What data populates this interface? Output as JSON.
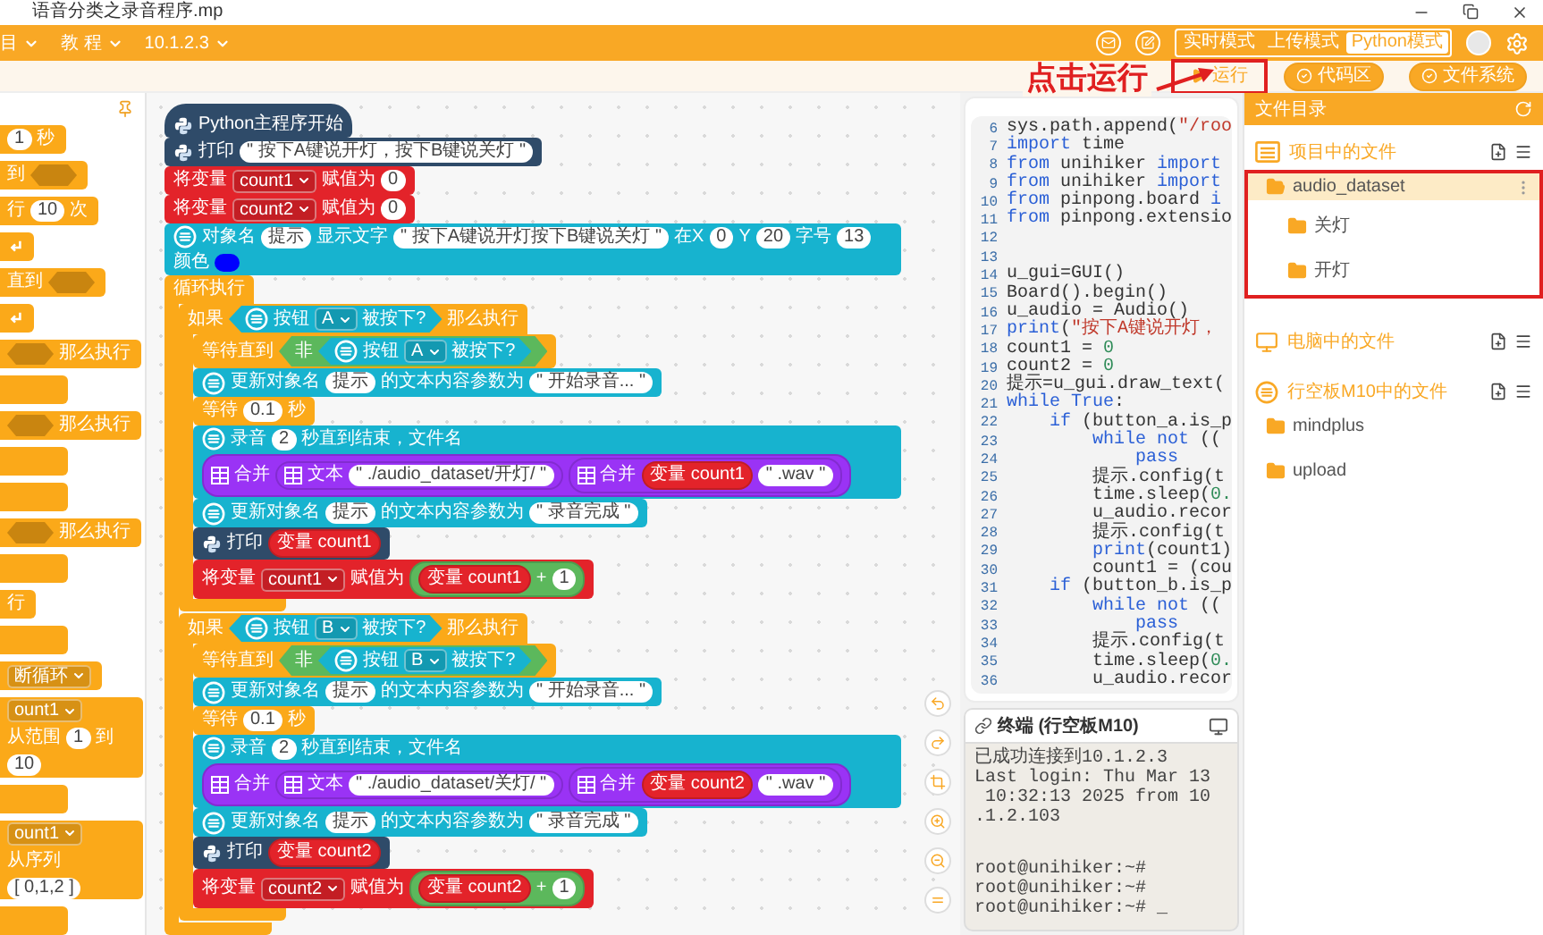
{
  "window": {
    "title": "语音分类之录音程序.mp"
  },
  "menus": [
    {
      "label": "目"
    },
    {
      "label": "教 程"
    },
    {
      "label": "10.1.2.3"
    }
  ],
  "modes": [
    {
      "label": "实时模式",
      "selected": false
    },
    {
      "label": "上传模式",
      "selected": false
    },
    {
      "label": "Python模式",
      "selected": true
    }
  ],
  "toolbar": [
    {
      "kind": "run",
      "label": "运行",
      "highlighted": true
    },
    {
      "kind": "toggle",
      "label": "代码区",
      "highlighted": false
    },
    {
      "kind": "toggle",
      "label": "文件系统",
      "highlighted": false
    }
  ],
  "annotation": {
    "text": "点击运行"
  },
  "palette": [
    {
      "kind": "block",
      "parts": [
        {
          "kind": "input",
          "text": "1"
        },
        {
          "kind": "label",
          "text": "秒"
        }
      ]
    },
    {
      "kind": "block",
      "parts": [
        {
          "kind": "label",
          "text": "到"
        },
        {
          "kind": "slot"
        }
      ]
    },
    {
      "kind": "block",
      "parts": [
        {
          "kind": "label",
          "text": "行"
        },
        {
          "kind": "input",
          "text": "10"
        },
        {
          "kind": "label",
          "text": "次"
        }
      ]
    },
    {
      "kind": "block",
      "parts": [
        {
          "kind": "arrow_icon"
        }
      ]
    },
    {
      "kind": "block",
      "parts": [
        {
          "kind": "label",
          "text": "直到"
        },
        {
          "kind": "slot"
        }
      ]
    },
    {
      "kind": "block",
      "parts": [
        {
          "kind": "arrow_icon"
        }
      ]
    },
    {
      "kind": "block",
      "parts": [
        {
          "kind": "slot"
        },
        {
          "kind": "label",
          "text": "那么执行"
        }
      ]
    },
    {
      "kind": "empty"
    },
    {
      "kind": "block",
      "parts": [
        {
          "kind": "slot"
        },
        {
          "kind": "label",
          "text": "那么执行"
        }
      ]
    },
    {
      "kind": "empty"
    },
    {
      "kind": "empty"
    },
    {
      "kind": "block",
      "parts": [
        {
          "kind": "slot"
        },
        {
          "kind": "label",
          "text": "那么执行"
        }
      ]
    },
    {
      "kind": "empty"
    },
    {
      "kind": "block",
      "parts": [
        {
          "kind": "label",
          "text": "行"
        }
      ]
    },
    {
      "kind": "empty"
    },
    {
      "kind": "block",
      "parts": [
        {
          "kind": "dropdown",
          "text": "断循环"
        }
      ]
    },
    {
      "kind": "block",
      "parts": [
        {
          "kind": "dropdown",
          "text": "ount1"
        },
        {
          "kind": "label",
          "text": "从范围"
        },
        {
          "kind": "input",
          "text": "1"
        },
        {
          "kind": "label",
          "text": "到"
        },
        {
          "kind": "input",
          "text": "10"
        }
      ]
    },
    {
      "kind": "empty"
    },
    {
      "kind": "block",
      "parts": [
        {
          "kind": "dropdown",
          "text": "ount1"
        },
        {
          "kind": "label",
          "text": "从序列"
        },
        {
          "kind": "input",
          "text": "[ 0,1,2 ]"
        }
      ]
    },
    {
      "kind": "empty"
    }
  ],
  "script": [
    {
      "kind": "python_hat",
      "parts": [
        {
          "kind": "python_icon"
        },
        {
          "kind": "label",
          "text": "Python主程序开始"
        }
      ]
    },
    {
      "kind": "python_statement",
      "parts": [
        {
          "kind": "python_icon"
        },
        {
          "kind": "label",
          "text": "打印"
        },
        {
          "kind": "input",
          "text": "\" 按下A键说开灯，按下B键说关灯 \""
        }
      ]
    },
    {
      "kind": "variable_statement",
      "parts": [
        {
          "kind": "label",
          "text": "将变量"
        },
        {
          "kind": "dropdown",
          "text": "count1"
        },
        {
          "kind": "label",
          "text": "赋值为"
        },
        {
          "kind": "input",
          "text": "0"
        }
      ]
    },
    {
      "kind": "variable_statement",
      "parts": [
        {
          "kind": "label",
          "text": "将变量"
        },
        {
          "kind": "dropdown",
          "text": "count2"
        },
        {
          "kind": "label",
          "text": "赋值为"
        },
        {
          "kind": "input",
          "text": "0"
        }
      ]
    },
    {
      "kind": "gui_statement",
      "parts": [
        {
          "kind": "gui_icon"
        },
        {
          "kind": "label",
          "text": "对象名"
        },
        {
          "kind": "input",
          "text": "提示"
        },
        {
          "kind": "label",
          "text": "显示文字"
        },
        {
          "kind": "input",
          "text": "\" 按下A键说开灯按下B键说关灯 \""
        },
        {
          "kind": "label",
          "text": "在X"
        },
        {
          "kind": "input",
          "text": "0"
        },
        {
          "kind": "label",
          "text": "Y"
        },
        {
          "kind": "input",
          "text": "20"
        },
        {
          "kind": "label",
          "text": "字号"
        },
        {
          "kind": "input",
          "text": "13"
        },
        {
          "kind": "label",
          "text": "颜色"
        },
        {
          "kind": "color",
          "color": "#0000ff"
        }
      ]
    },
    {
      "kind": "control_c_block",
      "parts": [
        {
          "kind": "label",
          "text": "循环执行"
        }
      ],
      "children": [
        {
          "kind": "control_c_block",
          "parts": [
            {
              "kind": "label",
              "text": "如果"
            },
            {
              "kind": "gui_condition",
              "parts": [
                {
                  "kind": "gui_icon"
                },
                {
                  "kind": "label",
                  "text": "按钮"
                },
                {
                  "kind": "dropdown",
                  "text": "A"
                },
                {
                  "kind": "label",
                  "text": "被按下?"
                }
              ]
            },
            {
              "kind": "label",
              "text": "那么执行"
            }
          ],
          "children": [
            {
              "kind": "control_statement",
              "parts": [
                {
                  "kind": "label",
                  "text": "等待直到"
                },
                {
                  "kind": "logic_condition",
                  "parts": [
                    {
                      "kind": "label",
                      "text": "非"
                    },
                    {
                      "kind": "gui_condition",
                      "parts": [
                        {
                          "kind": "gui_icon"
                        },
                        {
                          "kind": "label",
                          "text": "按钮"
                        },
                        {
                          "kind": "dropdown",
                          "text": "A"
                        },
                        {
                          "kind": "label",
                          "text": "被按下?"
                        }
                      ]
                    }
                  ]
                }
              ]
            },
            {
              "kind": "gui_statement",
              "parts": [
                {
                  "kind": "gui_icon"
                },
                {
                  "kind": "label",
                  "text": "更新对象名"
                },
                {
                  "kind": "input",
                  "text": "提示"
                },
                {
                  "kind": "label",
                  "text": "的文本内容参数为"
                },
                {
                  "kind": "input",
                  "text": "\" 开始录音... \""
                }
              ]
            },
            {
              "kind": "control_statement",
              "parts": [
                {
                  "kind": "label",
                  "text": "等待"
                },
                {
                  "kind": "input",
                  "text": "0.1"
                },
                {
                  "kind": "label",
                  "text": "秒"
                }
              ]
            },
            {
              "kind": "gui_statement",
              "parts": [
                {
                  "kind": "gui_icon"
                },
                {
                  "kind": "label",
                  "text": "录音"
                },
                {
                  "kind": "input",
                  "text": "2"
                },
                {
                  "kind": "label",
                  "text": "秒直到结束，文件名"
                },
                {
                  "kind": "text_reporter",
                  "parts": [
                    {
                      "kind": "text_icon"
                    },
                    {
                      "kind": "label",
                      "text": "合并"
                    },
                    {
                      "kind": "text_reporter",
                      "parts": [
                        {
                          "kind": "text_icon"
                        },
                        {
                          "kind": "label",
                          "text": "文本"
                        },
                        {
                          "kind": "input",
                          "text": "\" ./audio_dataset/开灯/ \""
                        }
                      ]
                    },
                    {
                      "kind": "text_reporter",
                      "parts": [
                        {
                          "kind": "text_icon"
                        },
                        {
                          "kind": "label",
                          "text": "合并"
                        },
                        {
                          "kind": "variable_reporter",
                          "parts": [
                            {
                              "kind": "label",
                              "text": "变量 count1"
                            }
                          ]
                        },
                        {
                          "kind": "input",
                          "text": "\" .wav \""
                        }
                      ]
                    }
                  ]
                }
              ]
            },
            {
              "kind": "gui_statement",
              "parts": [
                {
                  "kind": "gui_icon"
                },
                {
                  "kind": "label",
                  "text": "更新对象名"
                },
                {
                  "kind": "input",
                  "text": "提示"
                },
                {
                  "kind": "label",
                  "text": "的文本内容参数为"
                },
                {
                  "kind": "input",
                  "text": "\" 录音完成 \""
                }
              ]
            },
            {
              "kind": "python_statement",
              "parts": [
                {
                  "kind": "python_icon"
                },
                {
                  "kind": "label",
                  "text": "打印"
                },
                {
                  "kind": "variable_reporter",
                  "parts": [
                    {
                      "kind": "label",
                      "text": "变量 count1"
                    }
                  ]
                }
              ]
            },
            {
              "kind": "variable_statement",
              "parts": [
                {
                  "kind": "label",
                  "text": "将变量"
                },
                {
                  "kind": "dropdown",
                  "text": "count1"
                },
                {
                  "kind": "label",
                  "text": "赋值为"
                },
                {
                  "kind": "operator_reporter",
                  "parts": [
                    {
                      "kind": "variable_reporter",
                      "parts": [
                        {
                          "kind": "label",
                          "text": "变量 count1"
                        }
                      ]
                    },
                    {
                      "kind": "label",
                      "text": "+"
                    },
                    {
                      "kind": "input",
                      "text": "1"
                    }
                  ]
                }
              ]
            }
          ]
        },
        {
          "kind": "control_c_block",
          "parts": [
            {
              "kind": "label",
              "text": "如果"
            },
            {
              "kind": "gui_condition",
              "parts": [
                {
                  "kind": "gui_icon"
                },
                {
                  "kind": "label",
                  "text": "按钮"
                },
                {
                  "kind": "dropdown",
                  "text": "B"
                },
                {
                  "kind": "label",
                  "text": "被按下?"
                }
              ]
            },
            {
              "kind": "label",
              "text": "那么执行"
            }
          ],
          "children": [
            {
              "kind": "control_statement",
              "parts": [
                {
                  "kind": "label",
                  "text": "等待直到"
                },
                {
                  "kind": "logic_condition",
                  "parts": [
                    {
                      "kind": "label",
                      "text": "非"
                    },
                    {
                      "kind": "gui_condition",
                      "parts": [
                        {
                          "kind": "gui_icon"
                        },
                        {
                          "kind": "label",
                          "text": "按钮"
                        },
                        {
                          "kind": "dropdown",
                          "text": "B"
                        },
                        {
                          "kind": "label",
                          "text": "被按下?"
                        }
                      ]
                    }
                  ]
                }
              ]
            },
            {
              "kind": "gui_statement",
              "parts": [
                {
                  "kind": "gui_icon"
                },
                {
                  "kind": "label",
                  "text": "更新对象名"
                },
                {
                  "kind": "input",
                  "text": "提示"
                },
                {
                  "kind": "label",
                  "text": "的文本内容参数为"
                },
                {
                  "kind": "input",
                  "text": "\" 开始录音... \""
                }
              ]
            },
            {
              "kind": "control_statement",
              "parts": [
                {
                  "kind": "label",
                  "text": "等待"
                },
                {
                  "kind": "input",
                  "text": "0.1"
                },
                {
                  "kind": "label",
                  "text": "秒"
                }
              ]
            },
            {
              "kind": "gui_statement",
              "parts": [
                {
                  "kind": "gui_icon"
                },
                {
                  "kind": "label",
                  "text": "录音"
                },
                {
                  "kind": "input",
                  "text": "2"
                },
                {
                  "kind": "label",
                  "text": "秒直到结束，文件名"
                },
                {
                  "kind": "text_reporter",
                  "parts": [
                    {
                      "kind": "text_icon"
                    },
                    {
                      "kind": "label",
                      "text": "合并"
                    },
                    {
                      "kind": "text_reporter",
                      "parts": [
                        {
                          "kind": "text_icon"
                        },
                        {
                          "kind": "label",
                          "text": "文本"
                        },
                        {
                          "kind": "input",
                          "text": "\" ./audio_dataset/关灯/ \""
                        }
                      ]
                    },
                    {
                      "kind": "text_reporter",
                      "parts": [
                        {
                          "kind": "text_icon"
                        },
                        {
                          "kind": "label",
                          "text": "合并"
                        },
                        {
                          "kind": "variable_reporter",
                          "parts": [
                            {
                              "kind": "label",
                              "text": "变量 count2"
                            }
                          ]
                        },
                        {
                          "kind": "input",
                          "text": "\" .wav \""
                        }
                      ]
                    }
                  ]
                }
              ]
            },
            {
              "kind": "gui_statement",
              "parts": [
                {
                  "kind": "gui_icon"
                },
                {
                  "kind": "label",
                  "text": "更新对象名"
                },
                {
                  "kind": "input",
                  "text": "提示"
                },
                {
                  "kind": "label",
                  "text": "的文本内容参数为"
                },
                {
                  "kind": "input",
                  "text": "\" 录音完成 \""
                }
              ]
            },
            {
              "kind": "python_statement",
              "parts": [
                {
                  "kind": "python_icon"
                },
                {
                  "kind": "label",
                  "text": "打印"
                },
                {
                  "kind": "variable_reporter",
                  "parts": [
                    {
                      "kind": "label",
                      "text": "变量 count2"
                    }
                  ]
                }
              ]
            },
            {
              "kind": "variable_statement",
              "parts": [
                {
                  "kind": "label",
                  "text": "将变量"
                },
                {
                  "kind": "dropdown",
                  "text": "count2"
                },
                {
                  "kind": "label",
                  "text": "赋值为"
                },
                {
                  "kind": "operator_reporter",
                  "parts": [
                    {
                      "kind": "variable_reporter",
                      "parts": [
                        {
                          "kind": "label",
                          "text": "变量 count2"
                        }
                      ]
                    },
                    {
                      "kind": "label",
                      "text": "+"
                    },
                    {
                      "kind": "input",
                      "text": "1"
                    }
                  ]
                }
              ]
            }
          ]
        }
      ]
    }
  ],
  "code": [
    {
      "number": "6",
      "tokens": [
        {
          "kind": "plain",
          "text": "sys.path.append("
        },
        {
          "kind": "string",
          "text": "\"/roo"
        }
      ]
    },
    {
      "number": "7",
      "tokens": [
        {
          "kind": "keyword",
          "text": "import"
        },
        {
          "kind": "plain",
          "text": " time"
        }
      ]
    },
    {
      "number": "8",
      "tokens": [
        {
          "kind": "keyword",
          "text": "from"
        },
        {
          "kind": "plain",
          "text": " unihiker "
        },
        {
          "kind": "keyword",
          "text": "import"
        }
      ]
    },
    {
      "number": "9",
      "tokens": [
        {
          "kind": "keyword",
          "text": "from"
        },
        {
          "kind": "plain",
          "text": " unihiker "
        },
        {
          "kind": "keyword",
          "text": "import"
        }
      ]
    },
    {
      "number": "10",
      "tokens": [
        {
          "kind": "keyword",
          "text": "from"
        },
        {
          "kind": "plain",
          "text": " pinpong.board "
        },
        {
          "kind": "keyword",
          "text": "i"
        }
      ]
    },
    {
      "number": "11",
      "tokens": [
        {
          "kind": "keyword",
          "text": "from"
        },
        {
          "kind": "plain",
          "text": " pinpong.extensio"
        }
      ]
    },
    {
      "number": "12"
    },
    {
      "number": "13"
    },
    {
      "number": "14",
      "tokens": [
        {
          "kind": "plain",
          "text": "u_gui=GUI()"
        }
      ]
    },
    {
      "number": "15",
      "tokens": [
        {
          "kind": "plain",
          "text": "Board().begin()"
        }
      ]
    },
    {
      "number": "16",
      "tokens": [
        {
          "kind": "plain",
          "text": "u_audio = Audio()"
        }
      ]
    },
    {
      "number": "17",
      "tokens": [
        {
          "kind": "keyword",
          "text": "print"
        },
        {
          "kind": "plain",
          "text": "("
        },
        {
          "kind": "string",
          "text": "\"按下A键说开灯，"
        }
      ]
    },
    {
      "number": "18",
      "tokens": [
        {
          "kind": "plain",
          "text": "count1 = "
        },
        {
          "kind": "number",
          "text": "0"
        }
      ]
    },
    {
      "number": "19",
      "tokens": [
        {
          "kind": "plain",
          "text": "count2 = "
        },
        {
          "kind": "number",
          "text": "0"
        }
      ]
    },
    {
      "number": "20",
      "tokens": [
        {
          "kind": "plain",
          "text": "提示=u_gui.draw_text("
        }
      ]
    },
    {
      "number": "21",
      "tokens": [
        {
          "kind": "keyword",
          "text": "while True"
        },
        {
          "kind": "plain",
          "text": ":"
        }
      ]
    },
    {
      "number": "22",
      "tokens": [
        {
          "kind": "keyword",
          "text": "    if"
        },
        {
          "kind": "plain",
          "text": " (button_a.is_p"
        }
      ]
    },
    {
      "number": "23",
      "tokens": [
        {
          "kind": "keyword",
          "text": "        while not"
        },
        {
          "kind": "plain",
          "text": " (("
        }
      ]
    },
    {
      "number": "24",
      "tokens": [
        {
          "kind": "keyword",
          "text": "            pass"
        }
      ]
    },
    {
      "number": "25",
      "tokens": [
        {
          "kind": "plain",
          "text": "        提示.config(t"
        }
      ]
    },
    {
      "number": "26",
      "tokens": [
        {
          "kind": "plain",
          "text": "        time.sleep("
        },
        {
          "kind": "number",
          "text": "0."
        }
      ]
    },
    {
      "number": "27",
      "tokens": [
        {
          "kind": "plain",
          "text": "        u_audio.recor"
        }
      ]
    },
    {
      "number": "28",
      "tokens": [
        {
          "kind": "plain",
          "text": "        提示.config(t"
        }
      ]
    },
    {
      "number": "29",
      "tokens": [
        {
          "kind": "keyword",
          "text": "        print"
        },
        {
          "kind": "plain",
          "text": "(count1)"
        }
      ]
    },
    {
      "number": "30",
      "tokens": [
        {
          "kind": "plain",
          "text": "        count1 = (cou"
        }
      ]
    },
    {
      "number": "31",
      "tokens": [
        {
          "kind": "keyword",
          "text": "    if"
        },
        {
          "kind": "plain",
          "text": " (button_b.is_p"
        }
      ]
    },
    {
      "number": "32",
      "tokens": [
        {
          "kind": "keyword",
          "text": "        while not"
        },
        {
          "kind": "plain",
          "text": " (("
        }
      ]
    },
    {
      "number": "33",
      "tokens": [
        {
          "kind": "keyword",
          "text": "            pass"
        }
      ]
    },
    {
      "number": "34",
      "tokens": [
        {
          "kind": "plain",
          "text": "        提示.config(t"
        }
      ]
    },
    {
      "number": "35",
      "tokens": [
        {
          "kind": "plain",
          "text": "        time.sleep("
        },
        {
          "kind": "number",
          "text": "0."
        }
      ]
    },
    {
      "number": "36",
      "tokens": [
        {
          "kind": "plain",
          "text": "        u_audio.recor"
        }
      ]
    }
  ],
  "terminal": {
    "title": "终端 (行空板M10)",
    "output": [
      "已成功连接到10.1.2.3",
      "Last login: Thu Mar 13",
      " 10:32:13 2025 from 10",
      ".1.2.103"
    ],
    "prompts": [
      "root@unihiker:~#",
      "root@unihiker:~#",
      "root@unihiker:~# _"
    ]
  },
  "file_panel": {
    "title": "文件目录",
    "sections": [
      {
        "kind": "project",
        "title": "项目中的文件",
        "items": [
          {
            "name": "audio_dataset",
            "selected": true,
            "highlighted": true,
            "children": [
              {
                "name": "关灯",
                "selected": false,
                "highlighted": false
              },
              {
                "name": "开灯",
                "selected": false,
                "highlighted": false
              }
            ]
          }
        ]
      },
      {
        "kind": "computer",
        "title": "电脑中的文件"
      },
      {
        "kind": "device",
        "title": "行空板M10中的文件",
        "items": [
          {
            "name": "mindplus",
            "selected": false,
            "highlighted": false
          },
          {
            "name": "upload",
            "selected": false,
            "highlighted": false
          }
        ]
      }
    ]
  }
}
